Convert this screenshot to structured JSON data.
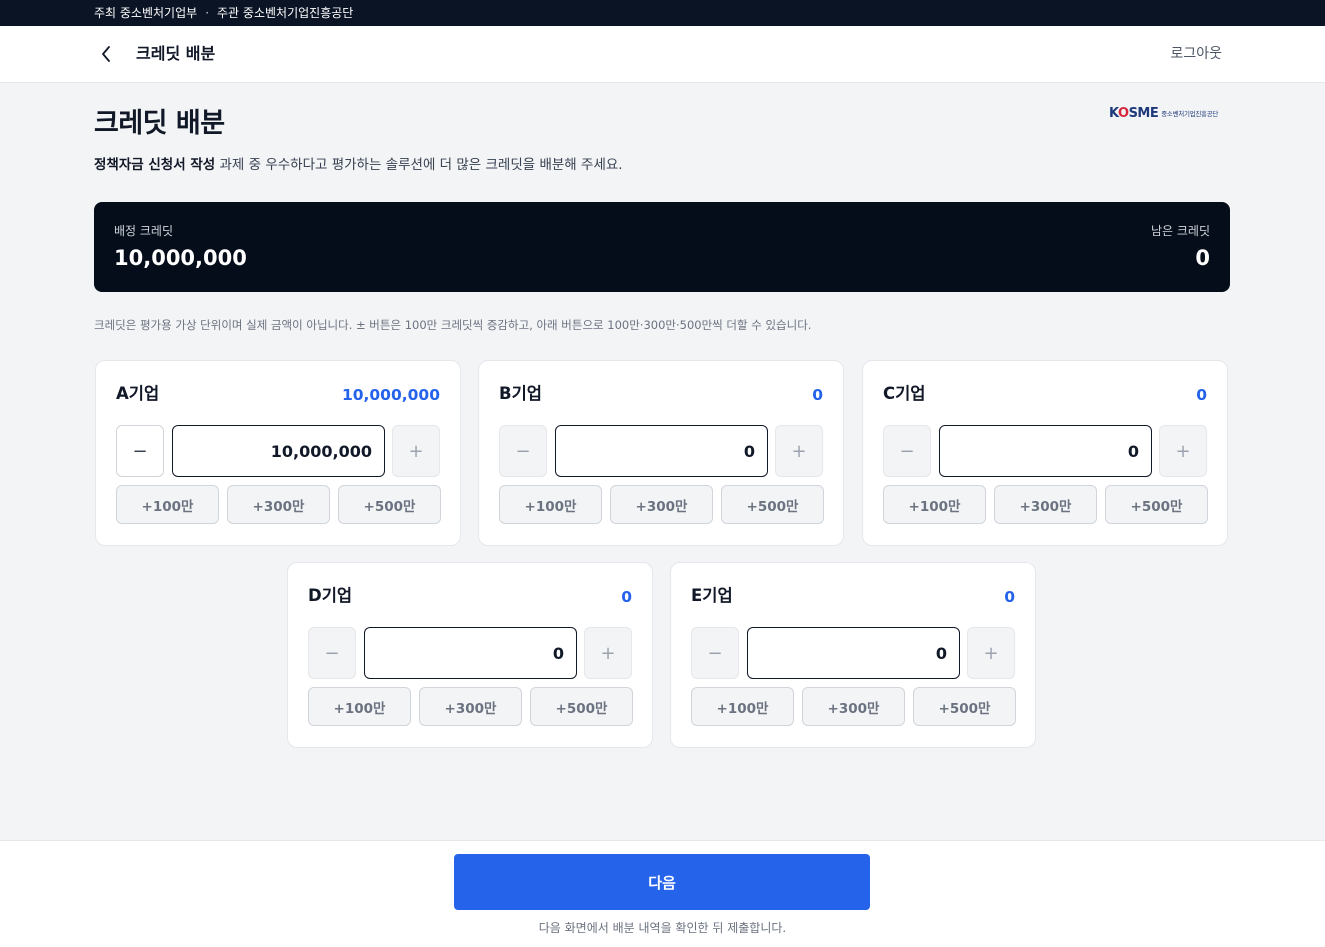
{
  "topbar": {
    "host": "주최 중소벤처기업부",
    "separator": "·",
    "organizer": "주관 중소벤처기업진흥공단"
  },
  "header": {
    "title": "크레딧 배분",
    "logout": "로그아웃",
    "back_icon": "chevron-left-icon"
  },
  "page": {
    "title": "크레딧 배분",
    "desc_bold": "정책자금 신청서 작성",
    "desc_rest": " 과제 중 우수하다고 평가하는 솔루션에 더 많은 크레딧을 배분해 주세요.",
    "logo_main_k": "K",
    "logo_main_o": "O",
    "logo_main_rest": "SME",
    "logo_sub": "중소벤처기업진흥공단"
  },
  "summary": {
    "allocated_label": "배정 크레딧",
    "allocated_value": "10,000,000",
    "remaining_label": "남은 크레딧",
    "remaining_value": "0"
  },
  "note": "크레딧은 평가용 가상 단위이며 실제 금액이 아닙니다. ± 버튼은 100만 크레딧씩 증감하고, 아래 버튼으로 100만·300만·500만씩 더할 수 있습니다.",
  "controls": {
    "minus": "−",
    "plus": "+",
    "quick": [
      "+100만",
      "+300만",
      "+500만"
    ]
  },
  "companies": [
    {
      "name": "A기업",
      "amount": "10,000,000",
      "input_value": "10,000,000"
    },
    {
      "name": "B기업",
      "amount": "0",
      "input_value": "0"
    },
    {
      "name": "C기업",
      "amount": "0",
      "input_value": "0"
    },
    {
      "name": "D기업",
      "amount": "0",
      "input_value": "0"
    },
    {
      "name": "E기업",
      "amount": "0",
      "input_value": "0"
    }
  ],
  "footer": {
    "next_label": "다음",
    "hint": "다음 화면에서 배분 내역을 확인한 뒤 제출합니다."
  },
  "colors": {
    "accent": "#2563eb",
    "dark": "#050d1a",
    "topbar": "#0b1424"
  }
}
